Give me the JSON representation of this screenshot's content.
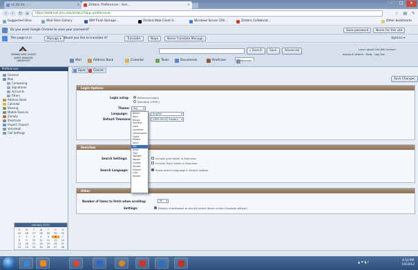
{
  "browser": {
    "tabs": [
      {
        "title": "a1:22:1e: ...",
        "active": false
      },
      {
        "title": "Zimbra: Preferences - Gen...",
        "active": true
      }
    ],
    "address": "https://webmail.jmu.edu/zimbra/?app=preferences",
    "bookmarks": [
      "Suggested Sites",
      "Web Slice Gallery",
      "IBM Tivoli Storage...",
      "Zimbra Web Client S...",
      "Windows Server 200...",
      "Zimbra Collaborat..."
    ],
    "other_bookmarks": "Other bookmarks",
    "colors": {
      "tabstrip": "#7990b3",
      "toolbar": "#eef2f8"
    }
  },
  "infobars": {
    "password": {
      "text": "Do you want Google Chrome to save your password?",
      "buttons": [
        "Save password",
        "Never for this site"
      ]
    },
    "translate": {
      "text": "This page is in",
      "language": "Manuge",
      "question": "Would you like to translate it?",
      "buttons": [
        "Translate",
        "Nope",
        "Never translate Manuge"
      ],
      "options": "Options"
    }
  },
  "app": {
    "logo_line1": "ZIMBRA WEB CLIENT",
    "logo_line2": "JAMES MADISON UNIVERSITY",
    "search_button": "Search",
    "save_search": "Save",
    "advanced": "Advanced",
    "header_info": "Learn about the JMU version",
    "header_links": [
      "Account: Admin",
      "Help",
      "Log Out"
    ],
    "main_tabs": [
      "Mail",
      "Address Book",
      "Calendar",
      "Tasks",
      "Documents",
      "Briefcase",
      "Preferences"
    ],
    "sub_buttons": [
      "Save",
      "Cancel"
    ],
    "save_changes": "Save Changes"
  },
  "left_nav": {
    "header": "Preferences",
    "items": [
      "General",
      "Mail",
      "Composing",
      "Signatures",
      "Accounts",
      "Filters",
      "Address Book",
      "Calendar",
      "Sharing",
      "Mobile Devices",
      "Zimlets",
      "Shortcuts",
      "Import / Export",
      "Voicemail",
      "Call Settings"
    ]
  },
  "calendar": {
    "header": "January 2012",
    "days": [
      "S",
      "M",
      "T",
      "W",
      "T",
      "F",
      "S",
      "25",
      "26",
      "27",
      "28",
      "29",
      "30",
      "31",
      "1",
      "2",
      "3",
      "4",
      "5",
      "6",
      "7",
      "8",
      "9",
      "10",
      "11",
      "12",
      "13",
      "14",
      "15",
      "16",
      "17",
      "18",
      "19",
      "20",
      "21",
      "22",
      "23",
      "24",
      "25",
      "26",
      "27",
      "28"
    ],
    "today": "6"
  },
  "login_options": {
    "section_title": "Login Options",
    "login_using_label": "Login using:",
    "radio_advanced": "Advanced (Ajax)",
    "radio_standard": "Standard (HTML)",
    "theme_label": "Theme:",
    "theme_value": "Sky",
    "language_label": "Language:",
    "language_value": "English",
    "timezone_label": "Default Timezone:",
    "timezone_value": "(GMT-05:00) Eastern"
  },
  "theme_options": [
    "Beach",
    "Bare",
    "Bones",
    "Hot Rod",
    "Lake",
    "Lavender",
    "Lemongrass",
    "Oasis",
    "Pebble",
    "Sand",
    "Sky",
    "Steel",
    "Tree",
    "Twilight",
    "Waves",
    "Carbon",
    "Smoke",
    "Hotrod",
    "Lilac",
    "Smoke"
  ],
  "theme_selected_index": 10,
  "searches": {
    "section_title": "Searches",
    "search_settings_label": "Search Settings:",
    "opt1": "Include Junk folder in Searches",
    "opt2": "Include Trash folder in Searches",
    "search_language_label": "Search Language:",
    "opt3": "Show search language in Search toolbar"
  },
  "other": {
    "section_title": "Other",
    "idle_label": "Number of items to fetch when scrolling:",
    "idle_value": "50",
    "settings_label": "Settings:",
    "settings_text": "Display checkboxes to quickly select items in lists (requires refresh)"
  },
  "taskbar": {
    "apps": [
      "explorer",
      "media-player",
      "chrome",
      "firefox",
      "outlook",
      "paint",
      "excel",
      "folder"
    ],
    "time": "4:53 PM",
    "date": "1/6/2012"
  }
}
